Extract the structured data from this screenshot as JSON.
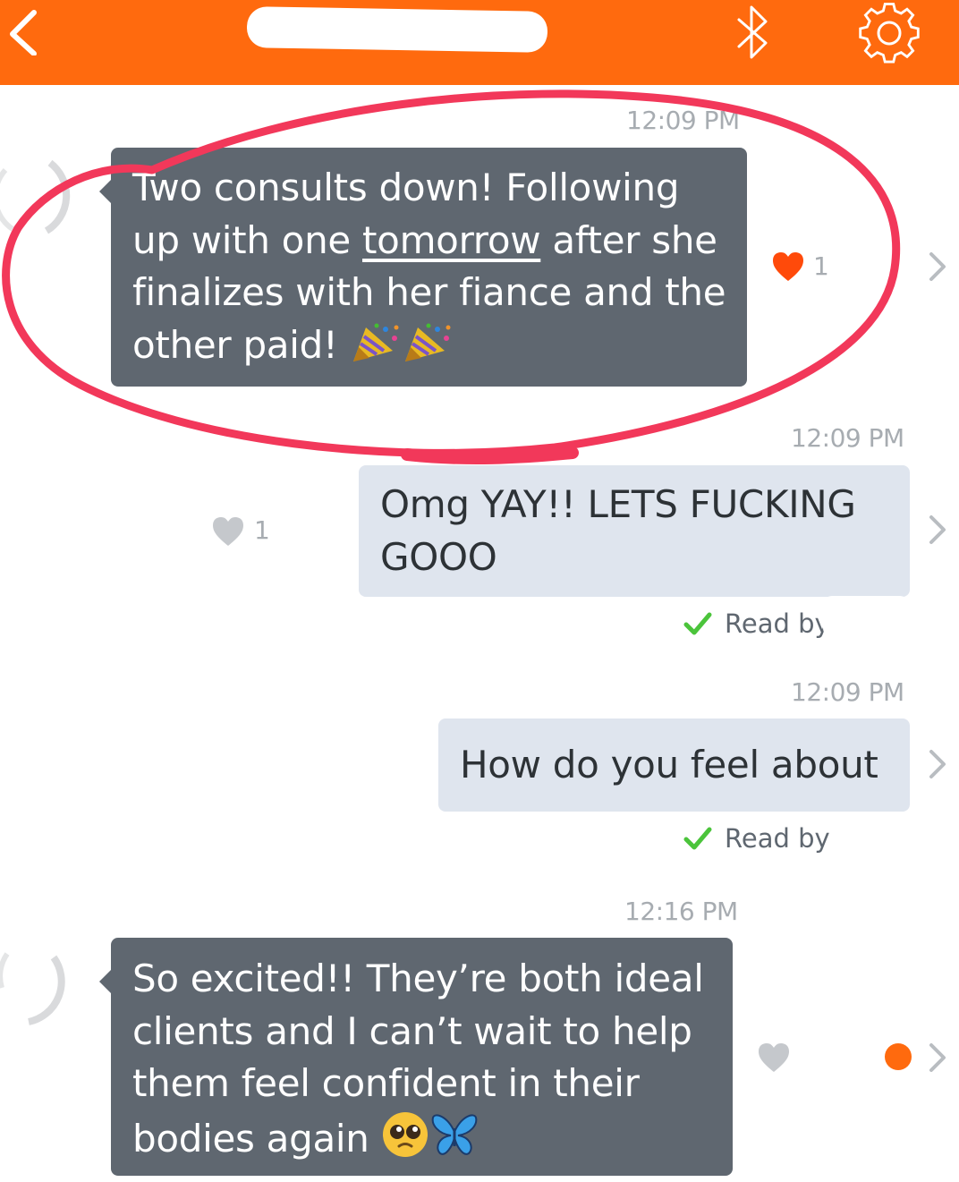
{
  "colors": {
    "header": "#ff6a0e",
    "incoming_bubble": "#5f6770",
    "outgoing_bubble": "#dfe5ee",
    "like_heart": "#ff4a0a",
    "read_check": "#4bc43b",
    "annotation_circle": "#f2385a"
  },
  "header": {
    "back_icon": "chevron-left-icon",
    "bluetooth_icon": "bluetooth-icon",
    "settings_icon": "gear-icon"
  },
  "messages": [
    {
      "direction": "incoming",
      "timestamp": "12:09 PM",
      "text_lines": [
        "Two consults down! Following",
        "up with one ",
        "tomorrow",
        " after she",
        "finalizes with her fiance and the",
        "other paid! "
      ],
      "emoji": [
        "party-popper-icon",
        "party-popper-icon"
      ],
      "likes": "1",
      "liked": true
    },
    {
      "direction": "outgoing",
      "timestamp": "12:09 PM",
      "text_lines": [
        "Omg YAY!! LETS FUCKING",
        "GOOO"
      ],
      "likes": "1",
      "read": "Read by"
    },
    {
      "direction": "outgoing",
      "timestamp": "12:09 PM",
      "text_lines": [
        "How do you feel about"
      ],
      "read": "Read by"
    },
    {
      "direction": "incoming",
      "timestamp": "12:16 PM",
      "text_lines": [
        "So excited!! They’re both ideal",
        "clients and I can’t wait to help",
        "them feel confident in their",
        "bodies again "
      ],
      "emoji": [
        "pleading-face-icon",
        "butterfly-icon"
      ]
    }
  ]
}
